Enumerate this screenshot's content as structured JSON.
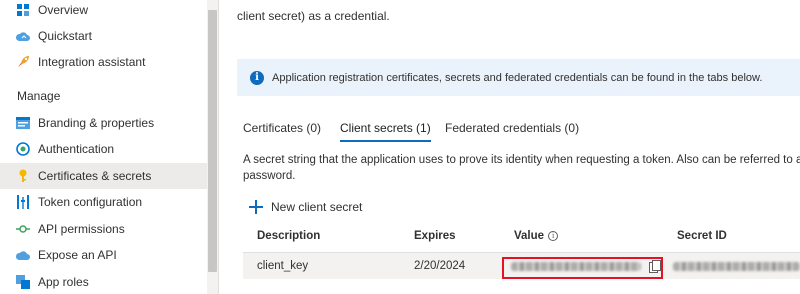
{
  "sidebar": {
    "items_top": [
      {
        "label": "Overview",
        "icon": "grid-icon"
      },
      {
        "label": "Quickstart",
        "icon": "cloud-icon"
      },
      {
        "label": "Integration assistant",
        "icon": "rocket-icon"
      }
    ],
    "section_label": "Manage",
    "items_manage": [
      {
        "label": "Branding & properties",
        "icon": "branding-icon"
      },
      {
        "label": "Authentication",
        "icon": "authentication-icon"
      },
      {
        "label": "Certificates & secrets",
        "icon": "key-icon",
        "active": true
      },
      {
        "label": "Token configuration",
        "icon": "token-bars-icon"
      },
      {
        "label": "API permissions",
        "icon": "api-permissions-icon"
      },
      {
        "label": "Expose an API",
        "icon": "cloud-icon"
      },
      {
        "label": "App roles",
        "icon": "app-roles-icon"
      }
    ]
  },
  "main": {
    "intro_text": "client secret) as a credential.",
    "info_bar_text": "Application registration certificates, secrets and federated credentials can be found in the tabs below.",
    "tabs": [
      {
        "label": "Certificates (0)"
      },
      {
        "label": "Client secrets (1)",
        "active": true
      },
      {
        "label": "Federated credentials (0)"
      }
    ],
    "description_line1": "A secret string that the application uses to prove its identity when requesting a token. Also can be referred to as application",
    "description_line2": "password.",
    "new_secret_label": "New client secret",
    "table": {
      "headers": [
        "Description",
        "Expires",
        "Value",
        "Secret ID"
      ],
      "rows": [
        {
          "description": "client_key",
          "expires": "2/20/2024"
        }
      ]
    }
  },
  "colors": {
    "accent": "#0f6cbd",
    "info_bar_bg": "#eaf2fb",
    "active_nav_bg": "#edebe9",
    "highlight_border": "#e81123"
  }
}
